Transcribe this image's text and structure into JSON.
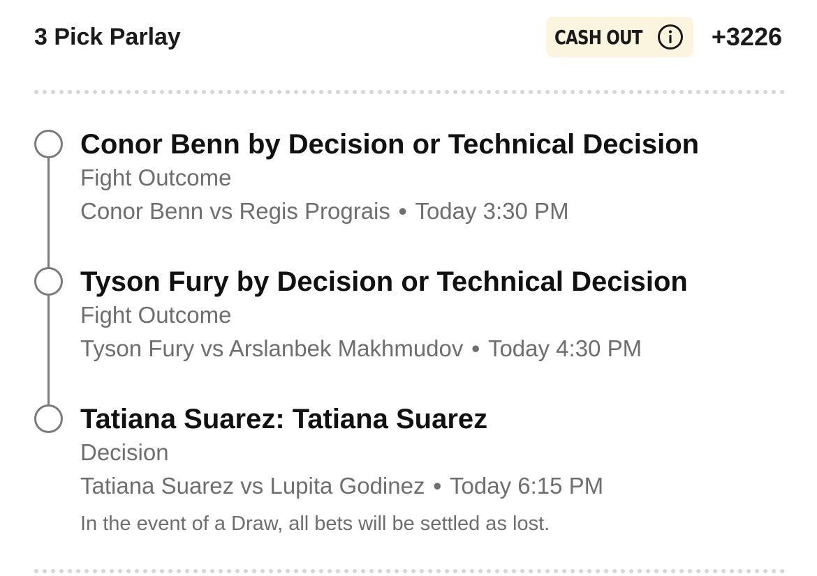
{
  "header": {
    "title": "3 Pick Parlay",
    "cash_out_label": "CASH OUT",
    "odds": "+3226"
  },
  "legs": [
    {
      "selection": "Conor Benn by Decision or Technical Decision",
      "market": "Fight Outcome",
      "matchup": "Conor Benn vs Regis Prograis",
      "separator": "•",
      "time": "Today 3:30 PM"
    },
    {
      "selection": "Tyson Fury by Decision or Technical Decision",
      "market": "Fight Outcome",
      "matchup": "Tyson Fury vs Arslanbek Makhmudov",
      "separator": "•",
      "time": "Today 4:30 PM"
    },
    {
      "selection": "Tatiana Suarez: Tatiana Suarez",
      "market": "Decision",
      "matchup": "Tatiana Suarez vs Lupita Godinez",
      "separator": "•",
      "time": "Today 6:15 PM",
      "note": "In the event of a Draw, all bets will be settled as lost."
    }
  ],
  "icons": {
    "info": "info-circle-icon"
  },
  "colors": {
    "cash_out_bg": "#fbf4de",
    "text_primary": "#111111",
    "text_secondary": "#6e6e6e",
    "timeline": "#7b7b7b"
  }
}
